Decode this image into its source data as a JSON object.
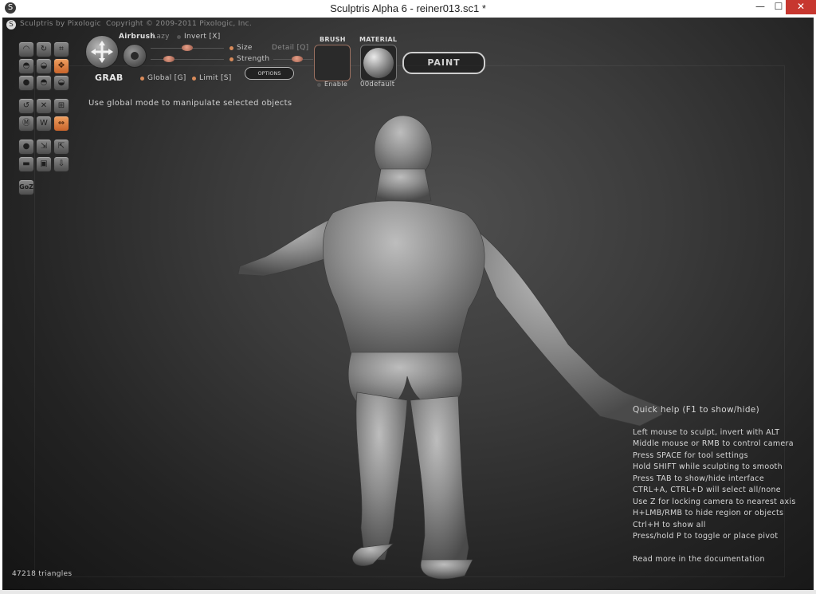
{
  "window": {
    "title": "Sculptris Alpha 6 - reiner013.sc1 *",
    "min_glyph": "—",
    "max_glyph": "☐",
    "close_glyph": "✕"
  },
  "header": {
    "brand": "Sculptris by Pixologic",
    "copyright": "Copyright © 2009-2011 Pixologic, Inc."
  },
  "toolbar": {
    "tool_name": "GRAB",
    "airbrush": "Airbrush",
    "lazy": "Lazy",
    "invert": "Invert [X]",
    "size": "Size",
    "detail": "Detail [Q]",
    "strength": "Strength",
    "options": "OPTIONS",
    "global": "Global [G]",
    "limit": "Limit [S]",
    "brush_label": "BRUSH",
    "brush_enable": "Enable",
    "material_label": "MATERIAL",
    "material_name": "00default",
    "paint": "PAINT",
    "size_value": 0.5,
    "strength_value": 0.25,
    "detail_value": 0.6
  },
  "tools": {
    "row1": [
      "draw-icon",
      "rotate-icon",
      "crop-icon"
    ],
    "row2": [
      "inflate-icon",
      "pinch-icon",
      "grab-icon"
    ],
    "row3": [
      "flatten-icon",
      "smooth-icon",
      "crease-icon"
    ],
    "row4": [
      "reduce-icon",
      "mask-icon",
      "subdivide-icon"
    ],
    "row5": [
      "symmetry-icon",
      "wire-icon",
      "transform-icon"
    ],
    "row6": [
      "sphere-icon",
      "scale-icon",
      "move-icon"
    ],
    "row7": [
      "plane-icon",
      "lock-icon",
      "import-icon"
    ],
    "goz": "GoZ",
    "active": "grab-icon"
  },
  "status": {
    "hint": "Use global mode to manipulate selected objects",
    "triangles": "47218 triangles"
  },
  "help": {
    "title": "Quick help (F1 to show/hide)",
    "lines": [
      "Left mouse to sculpt, invert with ALT",
      "Middle mouse or RMB to control camera",
      "Press SPACE for tool settings",
      "Hold SHIFT while sculpting to smooth",
      "Press TAB to show/hide interface",
      "CTRL+A, CTRL+D will select all/none",
      "Use Z for locking camera to nearest axis",
      "H+LMB/RMB to hide region or objects",
      "Ctrl+H to show all",
      "Press/hold P to toggle or place pivot"
    ],
    "footer": "Read more in the documentation"
  }
}
